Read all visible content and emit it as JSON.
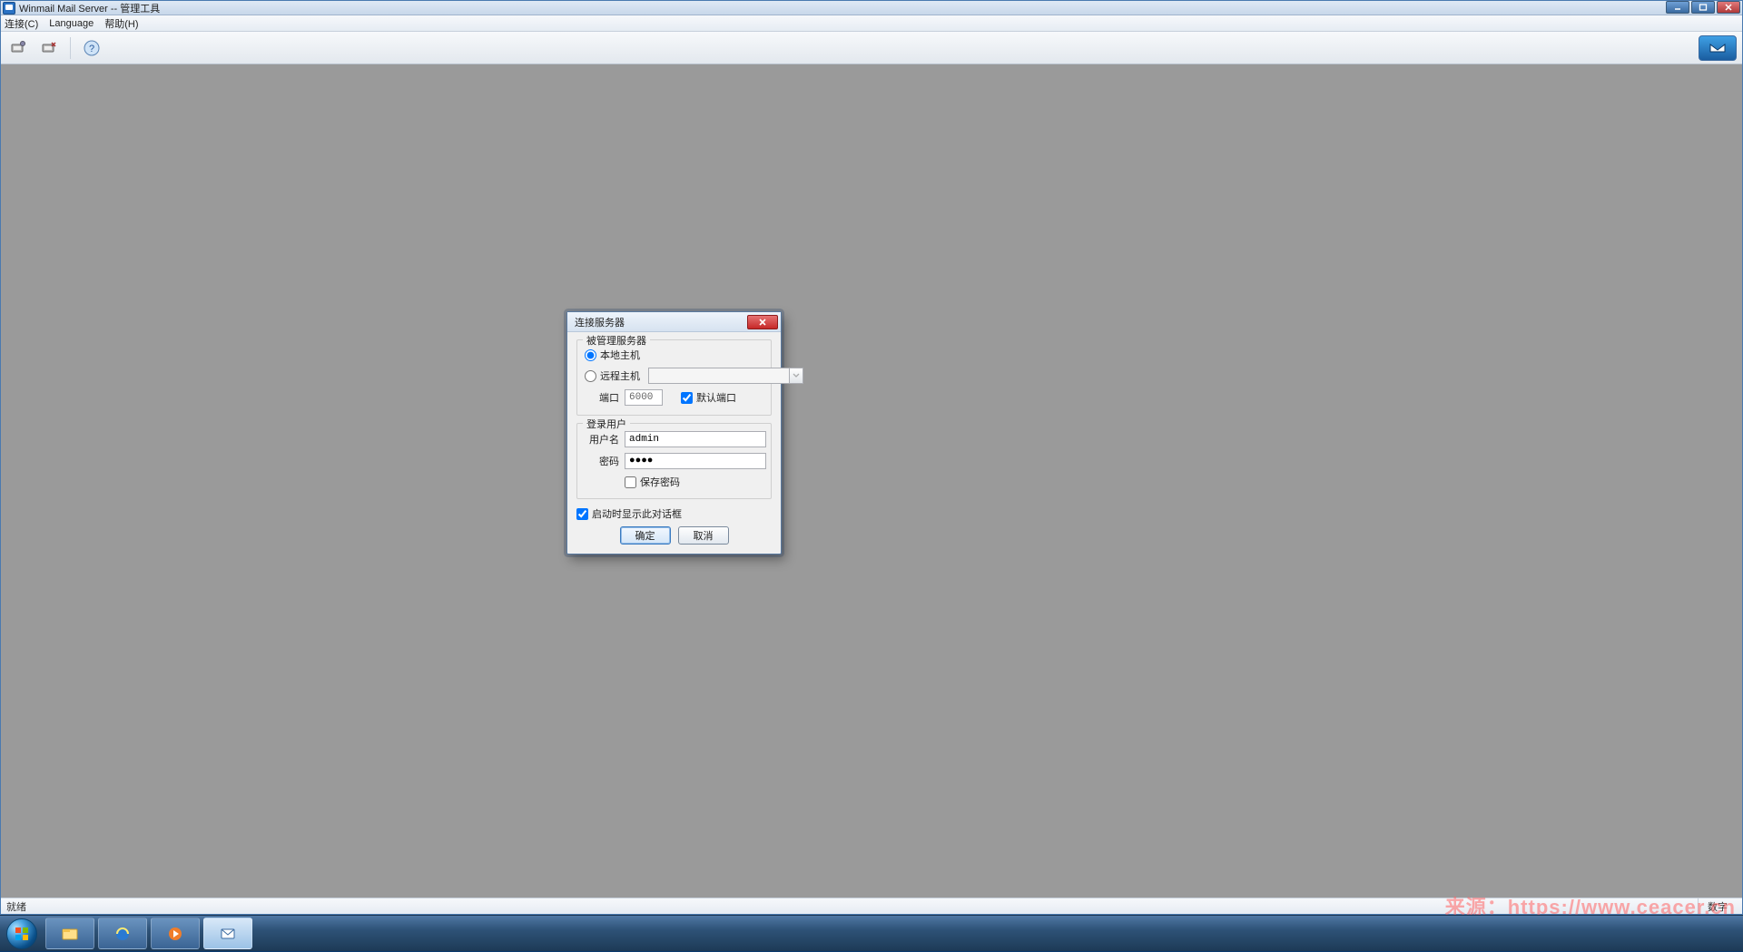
{
  "window": {
    "title": "Winmail Mail Server -- 管理工具",
    "menus": {
      "connect": "连接(C)",
      "language": "Language",
      "help": "帮助(H)"
    }
  },
  "status": {
    "ready": "就绪",
    "numlock": "数字"
  },
  "dialog": {
    "title": "连接服务器",
    "group_server_title": "被管理服务器",
    "radio_local": "本地主机",
    "radio_remote": "远程主机",
    "remote_host_value": "",
    "port_label": "端口",
    "port_value": "6000",
    "default_port_label": "默认端口",
    "default_port_checked": true,
    "group_login_title": "登录用户",
    "username_label": "用户名",
    "username_value": "admin",
    "password_label": "密码",
    "password_value": "●●●●",
    "save_password_label": "保存密码",
    "save_password_checked": false,
    "show_startup_label": "启动时显示此对话框",
    "show_startup_checked": true,
    "ok": "确定",
    "cancel": "取消"
  },
  "watermark": "来源：https://www.ceacer.cn"
}
